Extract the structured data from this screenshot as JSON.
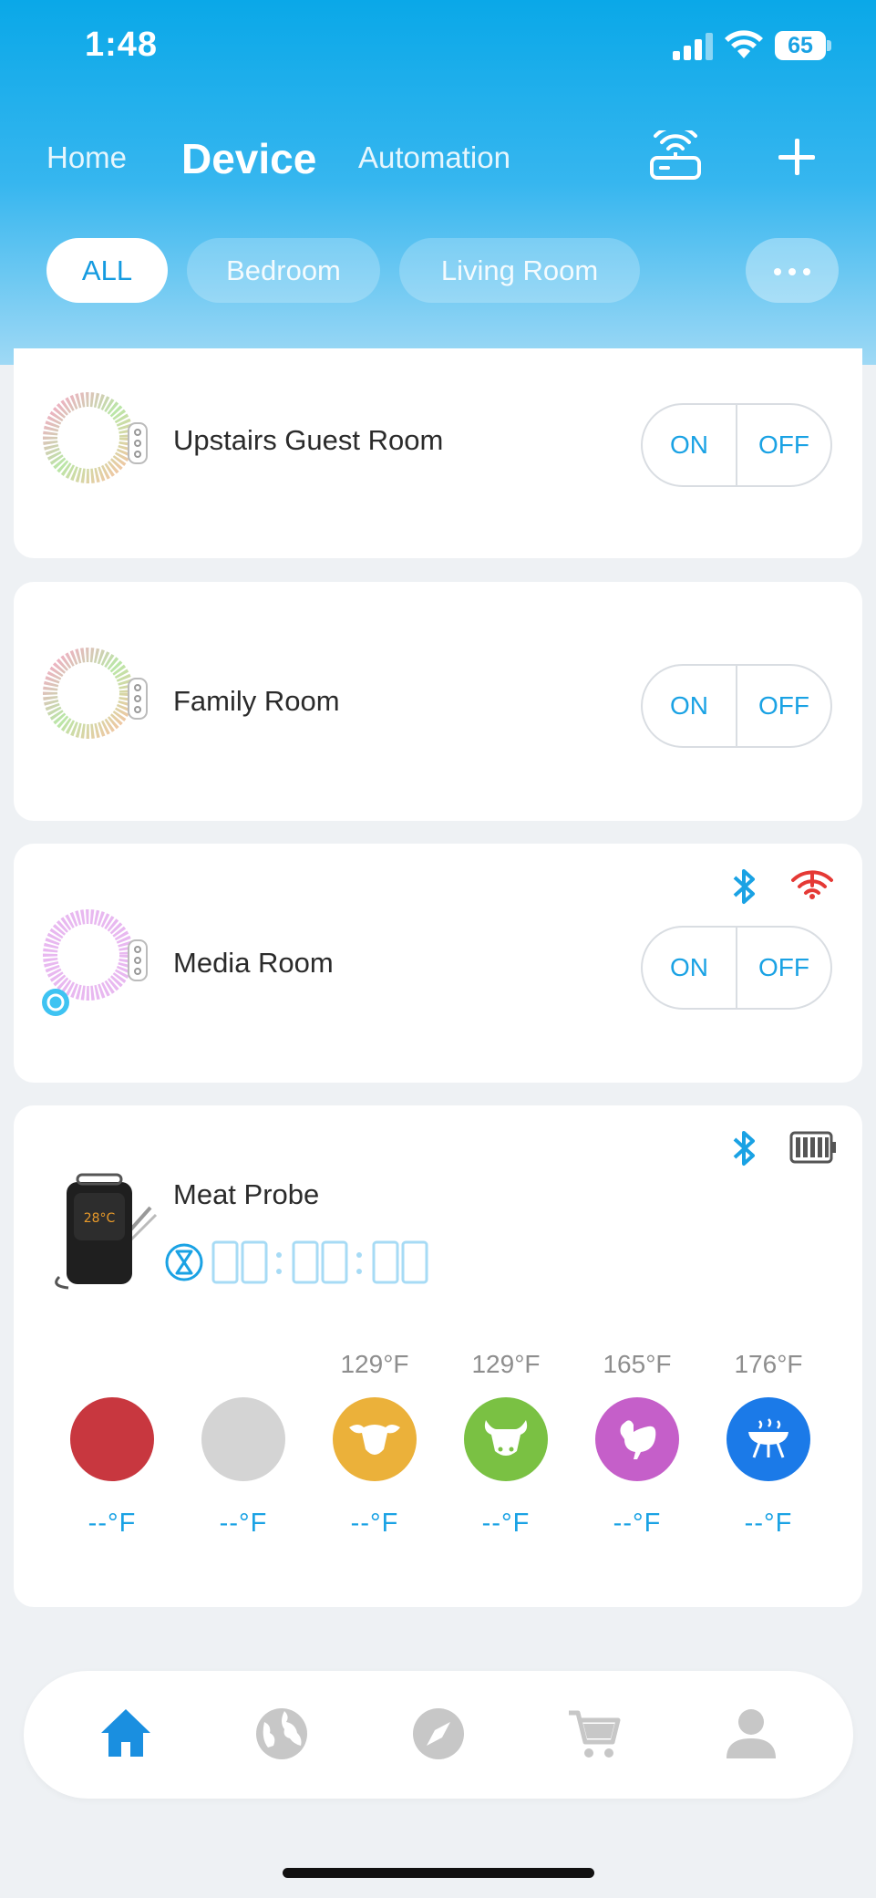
{
  "status_bar": {
    "time": "1:48",
    "battery": "65"
  },
  "top_nav": {
    "tabs": [
      "Home",
      "Device",
      "Automation"
    ],
    "active": "Device"
  },
  "filters": {
    "chips": [
      "ALL",
      "Bedroom",
      "Living Room"
    ],
    "active": "ALL"
  },
  "devices": [
    {
      "name": "Upstairs Guest Room",
      "on_label": "ON",
      "off_label": "OFF"
    },
    {
      "name": "Family Room",
      "on_label": "ON",
      "off_label": "OFF"
    },
    {
      "name": "Media Room",
      "on_label": "ON",
      "off_label": "OFF"
    }
  ],
  "meat_probe": {
    "name": "Meat Probe",
    "device_screen_text": "28°C",
    "probes": [
      {
        "set_temp": "",
        "current": "--°F",
        "color": "#c8373f",
        "icon": ""
      },
      {
        "set_temp": "",
        "current": "--°F",
        "color": "#d4d4d4",
        "icon": ""
      },
      {
        "set_temp": "129°F",
        "current": "--°F",
        "color": "#ebb13a",
        "icon": "lamb-icon"
      },
      {
        "set_temp": "129°F",
        "current": "--°F",
        "color": "#7ac143",
        "icon": "beef-icon"
      },
      {
        "set_temp": "165°F",
        "current": "--°F",
        "color": "#c55fc9",
        "icon": "chicken-icon"
      },
      {
        "set_temp": "176°F",
        "current": "--°F",
        "color": "#1b7ae8",
        "icon": "grill-icon"
      }
    ]
  },
  "bottom_tabs": [
    "home-icon",
    "globe-icon",
    "compass-icon",
    "cart-icon",
    "profile-icon"
  ],
  "colors": {
    "accent": "#1aa2e4",
    "header": "#0aa8e8",
    "warning": "#e53935"
  }
}
